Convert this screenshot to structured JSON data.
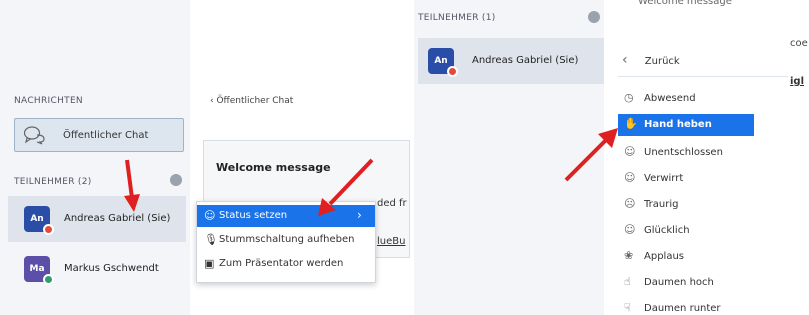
{
  "left": {
    "nachrichten_label": "NACHRICHTEN",
    "public_chat_label": "Öffentlicher Chat",
    "teilnehmer_label": "TEILNEHMER (2)",
    "users": [
      {
        "initials": "An",
        "name": "Andreas Gabriel (Sie)",
        "avatar_color": "#2a4ea8",
        "badge_color": "#e24a3b"
      },
      {
        "initials": "Ma",
        "name": "Markus Gschwendt",
        "avatar_color": "#5b4fa8",
        "badge_color": "#2f9e6a"
      }
    ]
  },
  "chat": {
    "back_label": "Öffentlicher Chat",
    "welcome_title": "Welcome message",
    "partial_text_1": "ded fr",
    "partial_text_2": "lueBu"
  },
  "context_menu": {
    "items": [
      {
        "label": "Status setzen",
        "icon": "user-icon"
      },
      {
        "label": "Stummschaltung aufheben",
        "icon": "microphone-icon"
      },
      {
        "label": "Zum Präsentator werden",
        "icon": "presentation-icon"
      }
    ]
  },
  "right": {
    "teilnehmer_label": "TEILNEHMER (1)",
    "user_initials": "An",
    "user_name": "Andreas Gabriel (Sie)",
    "header_partial": "Welcome message",
    "partial_side_1": "coe",
    "partial_side_2": "igl",
    "back_label": "Zurück",
    "status_items": [
      {
        "label": "Abwesend",
        "icon": "clock-icon"
      },
      {
        "label": "Hand heben",
        "icon": "hand-icon"
      },
      {
        "label": "Unentschlossen",
        "icon": "undecided-face-icon"
      },
      {
        "label": "Verwirrt",
        "icon": "confused-face-icon"
      },
      {
        "label": "Traurig",
        "icon": "sad-face-icon"
      },
      {
        "label": "Glücklich",
        "icon": "happy-face-icon"
      },
      {
        "label": "Applaus",
        "icon": "clap-icon"
      },
      {
        "label": "Daumen hoch",
        "icon": "thumbs-up-icon"
      },
      {
        "label": "Daumen runter",
        "icon": "thumbs-down-icon"
      }
    ]
  },
  "colors": {
    "accent": "#1a73e8",
    "arrow": "#e02020"
  }
}
